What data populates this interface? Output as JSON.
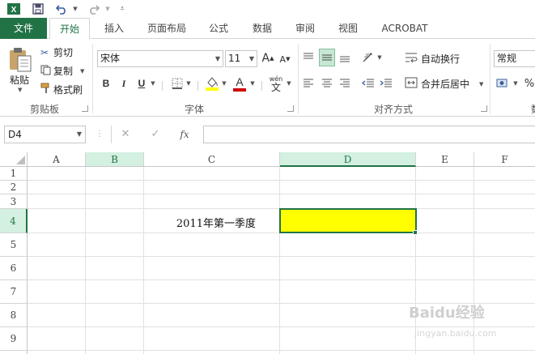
{
  "qat": {
    "app_icon": "excel-icon",
    "save_icon": "save-icon",
    "undo_icon": "undo-icon",
    "redo_icon": "redo-icon",
    "customize_icon": "customize-qat-icon"
  },
  "tabs": [
    {
      "label": "文件"
    },
    {
      "label": "开始"
    },
    {
      "label": "插入"
    },
    {
      "label": "页面布局"
    },
    {
      "label": "公式"
    },
    {
      "label": "数据"
    },
    {
      "label": "审阅"
    },
    {
      "label": "视图"
    },
    {
      "label": "ACROBAT"
    }
  ],
  "clipboard": {
    "paste": "粘贴",
    "cut": "剪切",
    "copy": "复制",
    "format_painter": "格式刷",
    "group_label": "剪贴板"
  },
  "font": {
    "font_name": "宋体",
    "font_size": "11",
    "grow": "A",
    "shrink": "A",
    "bold": "B",
    "italic": "I",
    "underline": "U",
    "font_color_letter": "A",
    "phonetic": "wén",
    "group_label": "字体",
    "fill_color": "#ffff00",
    "text_color": "#d00000"
  },
  "alignment": {
    "wrap_text": "自动换行",
    "merge_center": "合并后居中",
    "group_label": "对齐方式"
  },
  "number": {
    "format": "常规",
    "percent": "%"
  },
  "formula_bar": {
    "name_box": "D4",
    "cancel": "✕",
    "enter": "✓",
    "fx": "fx",
    "value": ""
  },
  "sheet": {
    "columns": [
      "A",
      "B",
      "C",
      "D",
      "E",
      "F"
    ],
    "rows": [
      "1",
      "2",
      "3",
      "4",
      "5",
      "6",
      "7",
      "8",
      "9"
    ],
    "c4_text": "2011年第一季度",
    "selected_cell": "D4",
    "d4_fill": "#ffff00"
  },
  "watermark": {
    "main": "Baidu经验",
    "sub": "jingyan.baidu.com"
  }
}
